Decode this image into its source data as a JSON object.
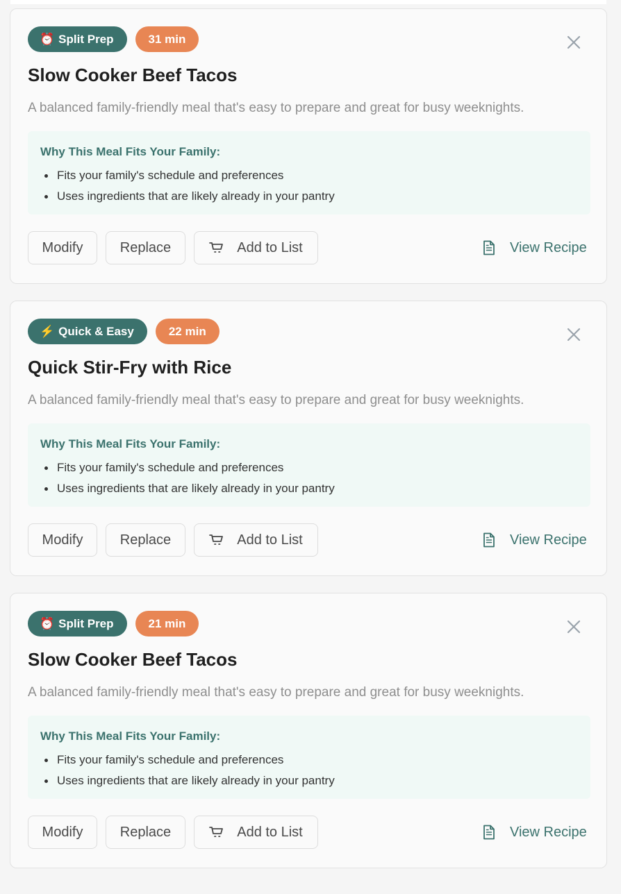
{
  "meals": [
    {
      "category": {
        "emoji": "⏰",
        "label": "Split Prep"
      },
      "time": "31 min",
      "title": "Slow Cooker Beef Tacos",
      "description": "A balanced family-friendly meal that's easy to prepare and great for busy weeknights.",
      "why_title": "Why This Meal Fits Your Family:",
      "reasons": [
        "Fits your family's schedule and preferences",
        "Uses ingredients that are likely already in your pantry"
      ],
      "actions": {
        "modify": "Modify",
        "replace": "Replace",
        "add_to_list": "Add to List",
        "view_recipe": "View Recipe"
      }
    },
    {
      "category": {
        "emoji": "⚡",
        "label": "Quick & Easy"
      },
      "time": "22 min",
      "title": "Quick Stir-Fry with Rice",
      "description": "A balanced family-friendly meal that's easy to prepare and great for busy weeknights.",
      "why_title": "Why This Meal Fits Your Family:",
      "reasons": [
        "Fits your family's schedule and preferences",
        "Uses ingredients that are likely already in your pantry"
      ],
      "actions": {
        "modify": "Modify",
        "replace": "Replace",
        "add_to_list": "Add to List",
        "view_recipe": "View Recipe"
      }
    },
    {
      "category": {
        "emoji": "⏰",
        "label": "Split Prep"
      },
      "time": "21 min",
      "title": "Slow Cooker Beef Tacos",
      "description": "A balanced family-friendly meal that's easy to prepare and great for busy weeknights.",
      "why_title": "Why This Meal Fits Your Family:",
      "reasons": [
        "Fits your family's schedule and preferences",
        "Uses ingredients that are likely already in your pantry"
      ],
      "actions": {
        "modify": "Modify",
        "replace": "Replace",
        "add_to_list": "Add to List",
        "view_recipe": "View Recipe"
      }
    }
  ],
  "icons": {
    "close": "close-icon",
    "cart": "cart-icon",
    "recipe": "document-icon"
  },
  "colors": {
    "category_badge": "#3b726d",
    "time_badge": "#e88654",
    "accent_text": "#3b726d",
    "why_box_background": "#f0f9f6"
  }
}
